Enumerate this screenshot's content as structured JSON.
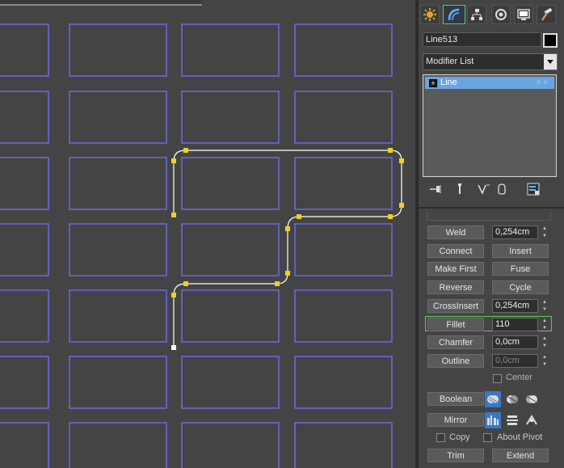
{
  "command_tabs": [
    {
      "name": "create-tab",
      "icon": "sun-icon"
    },
    {
      "name": "modify-tab",
      "icon": "bend-icon",
      "active": true
    },
    {
      "name": "hierarchy-tab",
      "icon": "hierarchy-icon"
    },
    {
      "name": "motion-tab",
      "icon": "motion-icon"
    },
    {
      "name": "display-tab",
      "icon": "monitor-icon"
    },
    {
      "name": "utilities-tab",
      "icon": "hammer-icon"
    }
  ],
  "object": {
    "name": "Line513",
    "color": "#000000"
  },
  "modifier_list": {
    "label": "Modifier List"
  },
  "stack": {
    "items": [
      {
        "label": "Line",
        "expand": "+"
      }
    ]
  },
  "geometry": {
    "weld": {
      "label": "Weld",
      "value": "0,254cm"
    },
    "connect": {
      "label": "Connect"
    },
    "insert": {
      "label": "Insert"
    },
    "make_first": {
      "label": "Make First"
    },
    "fuse": {
      "label": "Fuse"
    },
    "reverse": {
      "label": "Reverse"
    },
    "cycle": {
      "label": "Cycle"
    },
    "crossinsert": {
      "label": "CrossInsert",
      "value": "0,254cm"
    },
    "fillet": {
      "label": "Fillet",
      "value": "110"
    },
    "chamfer": {
      "label": "Chamfer",
      "value": "0,0cm"
    },
    "outline": {
      "label": "Outline",
      "value": "0,0cm"
    },
    "center": {
      "label": "Center",
      "checked": false
    },
    "boolean": {
      "label": "Boolean"
    },
    "mirror": {
      "label": "Mirror"
    },
    "copy": {
      "label": "Copy",
      "checked": false
    },
    "about_pivot": {
      "label": "About Pivot",
      "checked": false
    },
    "trim": {
      "label": "Trim"
    },
    "extend": {
      "label": "Extend"
    }
  },
  "colors": {
    "viewport_bg": "#444444",
    "grid_rect": "#6a6ae6",
    "spline": "#ffffff",
    "vertex": "#f0d020",
    "selection_blue": "#3a78c4",
    "highlight_green": "#5fc95f"
  }
}
